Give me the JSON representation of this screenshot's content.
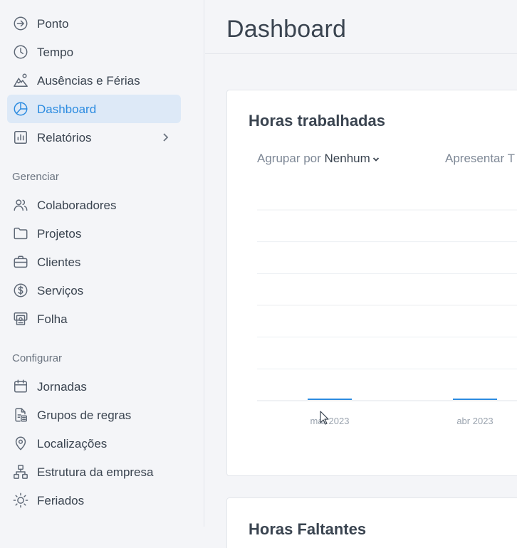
{
  "sidebar": {
    "items": [
      {
        "label": "Ponto",
        "icon": "login-arrow-icon"
      },
      {
        "label": "Tempo",
        "icon": "clock-icon"
      },
      {
        "label": "Ausências e Férias",
        "icon": "mountain-icon"
      },
      {
        "label": "Dashboard",
        "icon": "pie-chart-icon",
        "active": true
      },
      {
        "label": "Relatórios",
        "icon": "bar-chart-icon",
        "has_children": true
      }
    ],
    "manage": {
      "title": "Gerenciar",
      "items": [
        {
          "label": "Colaboradores",
          "icon": "users-icon"
        },
        {
          "label": "Projetos",
          "icon": "folder-icon"
        },
        {
          "label": "Clientes",
          "icon": "briefcase-icon"
        },
        {
          "label": "Serviços",
          "icon": "dollar-circle-icon"
        },
        {
          "label": "Folha",
          "icon": "payroll-icon"
        }
      ]
    },
    "configure": {
      "title": "Configurar",
      "items": [
        {
          "label": "Jornadas",
          "icon": "calendar-icon"
        },
        {
          "label": "Grupos de regras",
          "icon": "rules-document-icon"
        },
        {
          "label": "Localizações",
          "icon": "map-pin-icon"
        },
        {
          "label": "Estrutura da empresa",
          "icon": "org-chart-icon"
        },
        {
          "label": "Feriados",
          "icon": "sun-icon"
        }
      ]
    }
  },
  "header": {
    "title": "Dashboard"
  },
  "cards": {
    "worked_hours": {
      "title": "Horas trabalhadas",
      "group_by_label": "Agrupar por",
      "group_by_value": "Nenhum",
      "show_label": "Apresentar T"
    },
    "missing_hours": {
      "title": "Horas Faltantes"
    }
  },
  "colors": {
    "accent": "#2b8be0",
    "active_bg": "#dde9f7",
    "text": "#3a4450",
    "muted": "#7e8896"
  },
  "chart_data": {
    "type": "bar",
    "categories": [
      "mar 2023",
      "abr 2023"
    ],
    "values": [
      0,
      0
    ],
    "grid": true
  }
}
